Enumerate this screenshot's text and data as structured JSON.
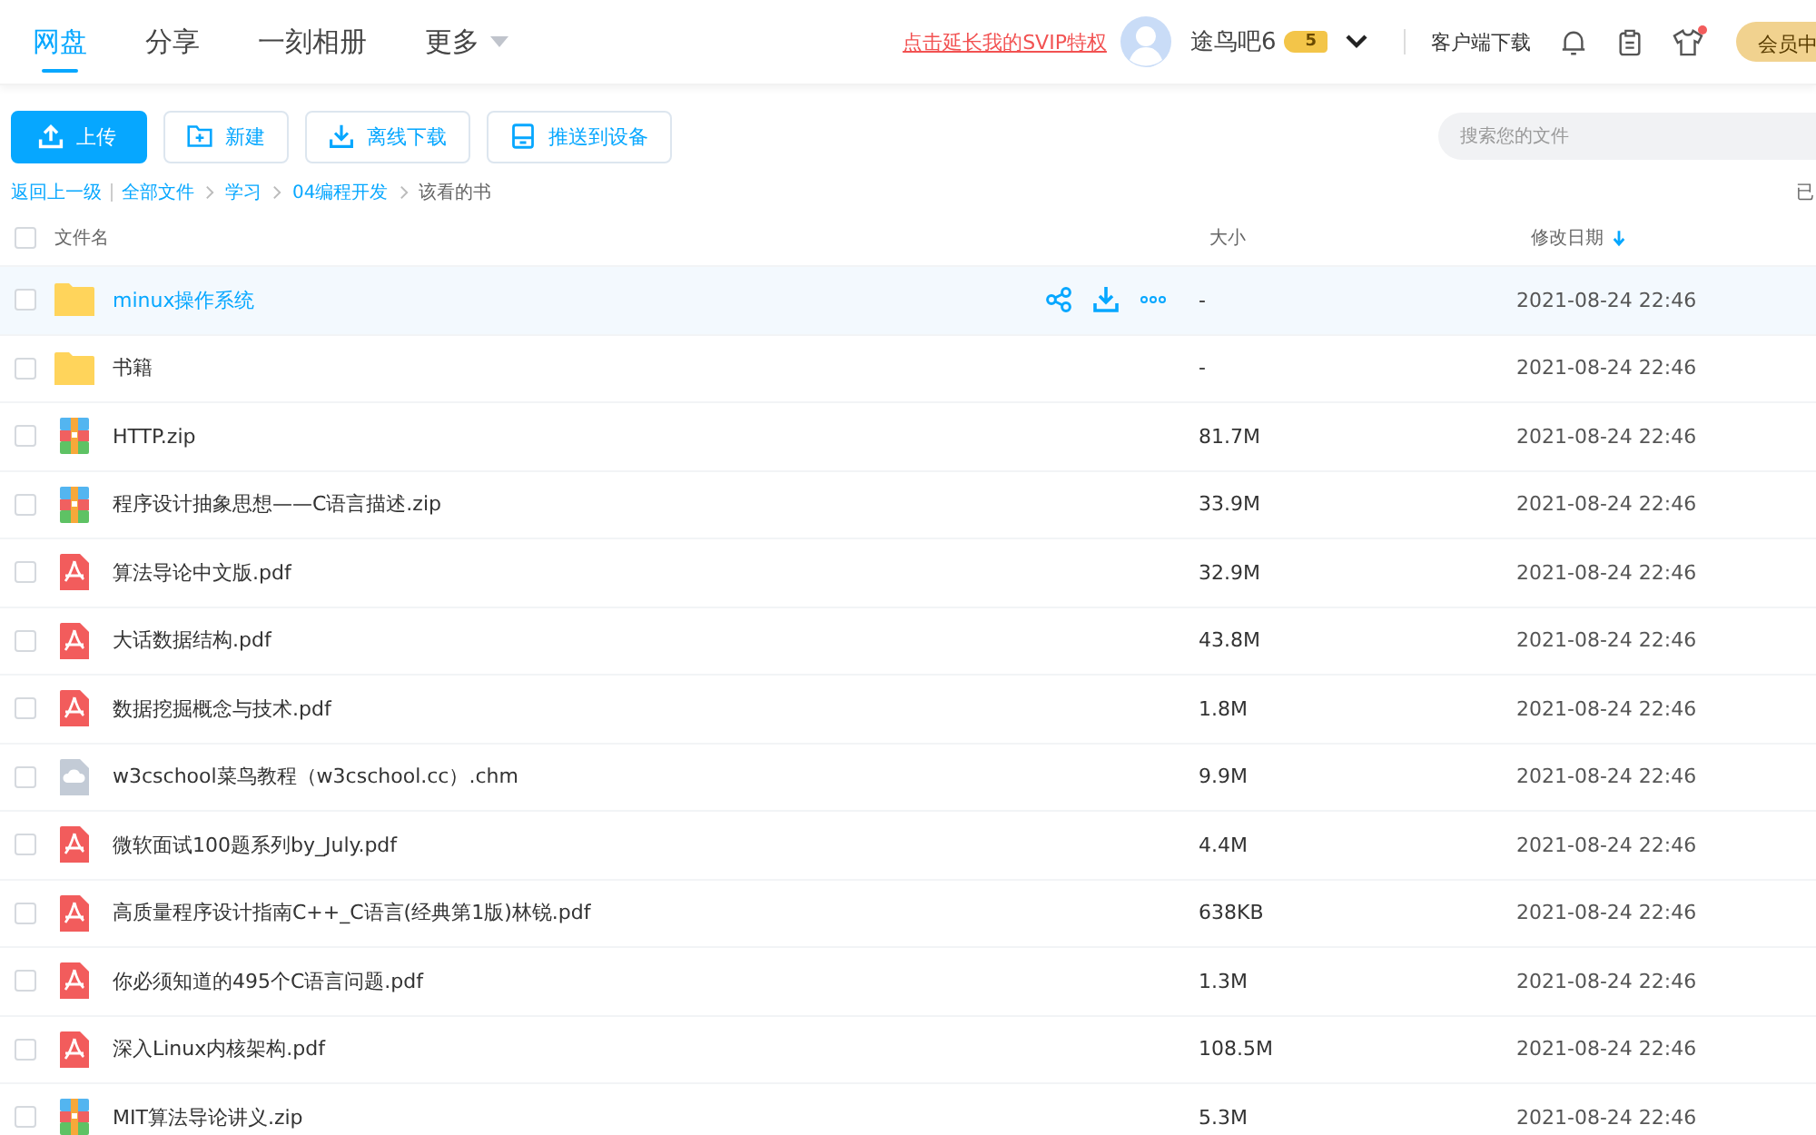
{
  "nav": {
    "tabs": [
      {
        "label": "网盘",
        "selected": true
      },
      {
        "label": "分享",
        "selected": false
      },
      {
        "label": "一刻相册",
        "selected": false
      },
      {
        "label": "更多",
        "selected": false,
        "dropdown": true
      }
    ],
    "promo": "点击延长我的SVIP特权",
    "user": "途鸟吧6",
    "level": "5",
    "client_download": "客户端下载",
    "notification_dot": true,
    "member": "会员中"
  },
  "toolbar": {
    "buttons": [
      {
        "label": "上传",
        "kind": "upload"
      },
      {
        "label": "新建",
        "kind": "new"
      },
      {
        "label": "离线下载",
        "kind": "download"
      },
      {
        "label": "推送到设备",
        "kind": "push"
      }
    ],
    "search": {
      "placeholder": "搜索您的文件"
    }
  },
  "breadcrumb": {
    "back": "返回上一级",
    "path": [
      "全部文件",
      "学习",
      "04编程开发"
    ],
    "current": "该看的书",
    "right_text": "已"
  },
  "table": {
    "select_all_checked": false,
    "columns": [
      "文件名",
      "大小",
      "修改日期"
    ],
    "rows": [
      {
        "name": "minux操作系统",
        "kind": "folder",
        "size": "-",
        "date": "2021-08-24 22:46",
        "hovered": true,
        "checked": false
      },
      {
        "name": "书籍",
        "kind": "folder",
        "size": "-",
        "date": "2021-08-24 22:46",
        "hovered": false,
        "checked": false
      },
      {
        "name": "HTTP.zip",
        "kind": "zip",
        "size": "81.7M",
        "date": "2021-08-24 22:46",
        "hovered": false,
        "checked": false
      },
      {
        "name": "程序设计抽象思想——C语言描述.zip",
        "kind": "zip",
        "size": "33.9M",
        "date": "2021-08-24 22:46",
        "hovered": false,
        "checked": false
      },
      {
        "name": "算法导论中文版.pdf",
        "kind": "pdf",
        "size": "32.9M",
        "date": "2021-08-24 22:46",
        "hovered": false,
        "checked": false
      },
      {
        "name": "大话数据结构.pdf",
        "kind": "pdf",
        "size": "43.8M",
        "date": "2021-08-24 22:46",
        "hovered": false,
        "checked": false
      },
      {
        "name": "数据挖掘概念与技术.pdf",
        "kind": "pdf",
        "size": "1.8M",
        "date": "2021-08-24 22:46",
        "hovered": false,
        "checked": false
      },
      {
        "name": "w3cschool菜鸟教程（w3cschool.cc）.chm",
        "kind": "chm",
        "size": "9.9M",
        "date": "2021-08-24 22:46",
        "hovered": false,
        "checked": false
      },
      {
        "name": "微软面试100题系列by_July.pdf",
        "kind": "pdf",
        "size": "4.4M",
        "date": "2021-08-24 22:46",
        "hovered": false,
        "checked": false
      },
      {
        "name": "高质量程序设计指南C++_C语言(经典第1版)林锐.pdf",
        "kind": "pdf",
        "size": "638KB",
        "date": "2021-08-24 22:46",
        "hovered": false,
        "checked": false
      },
      {
        "name": "你必须知道的495个C语言问题.pdf",
        "kind": "pdf",
        "size": "1.3M",
        "date": "2021-08-24 22:46",
        "hovered": false,
        "checked": false
      },
      {
        "name": "深入Linux内核架构.pdf",
        "kind": "pdf",
        "size": "108.5M",
        "date": "2021-08-24 22:46",
        "hovered": false,
        "checked": false
      },
      {
        "name": "MIT算法导论讲义.zip",
        "kind": "zip",
        "size": "5.3M",
        "date": "2021-08-24 22:46",
        "hovered": false,
        "checked": false
      }
    ]
  }
}
